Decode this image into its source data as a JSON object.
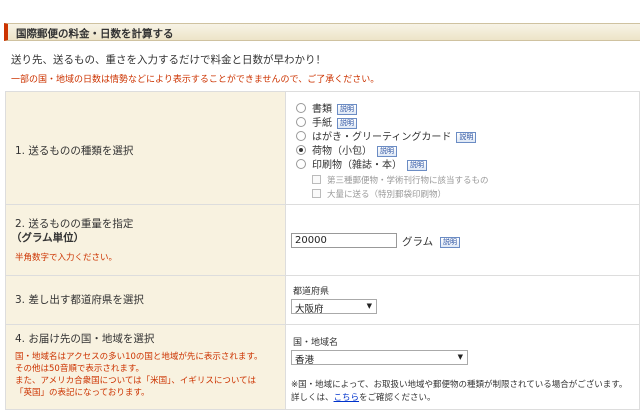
{
  "header": {
    "title": "国際郵便の料金・日数を計算する"
  },
  "intro": "送り先、送るもの、重さを入力するだけで料金と日数が早わかり！",
  "note": "一部の国・地域の日数は情勢などにより表示することができませんので、ご了承ください。",
  "help_label": "説明",
  "section1": {
    "label": "1. 送るものの種類を選択",
    "options": [
      {
        "label": "書類",
        "selected": false
      },
      {
        "label": "手紙",
        "selected": false
      },
      {
        "label": "はがき・グリーティングカード",
        "selected": false
      },
      {
        "label": "荷物（小包）",
        "selected": true
      },
      {
        "label": "印刷物（雑誌・本）",
        "selected": false
      }
    ],
    "sub_options": [
      "第三種郵便物・学術刊行物に該当するもの",
      "大量に送る（特別郵袋印刷物）"
    ]
  },
  "section2": {
    "label_line1": "2. 送るものの重量を指定",
    "label_line2": "（グラム単位）",
    "hint": "半角数字で入力ください。",
    "weight_value": "20000",
    "unit": "グラム"
  },
  "section3": {
    "label": "3. 差し出す都道府県を選択",
    "field_label": "都道府県",
    "selected": "大阪府"
  },
  "section4": {
    "label": "4. お届け先の国・地域を選択",
    "desc_lines": [
      "国・地域名はアクセスの多い10の国と地域が先に表示されます。",
      "その他は50音順で表示されます。",
      "また、アメリカ合衆国については「米国」、イギリスについては",
      "「英国」の表記になっております。"
    ],
    "field_label": "国・地域名",
    "selected": "香港",
    "warning_line1": "※国・地域によって、お取扱い地域や郵便物の種類が制限されている場合がございます。",
    "warning_pre": "詳しくは、",
    "warning_link": "こちら",
    "warning_post": "をご確認ください。"
  }
}
